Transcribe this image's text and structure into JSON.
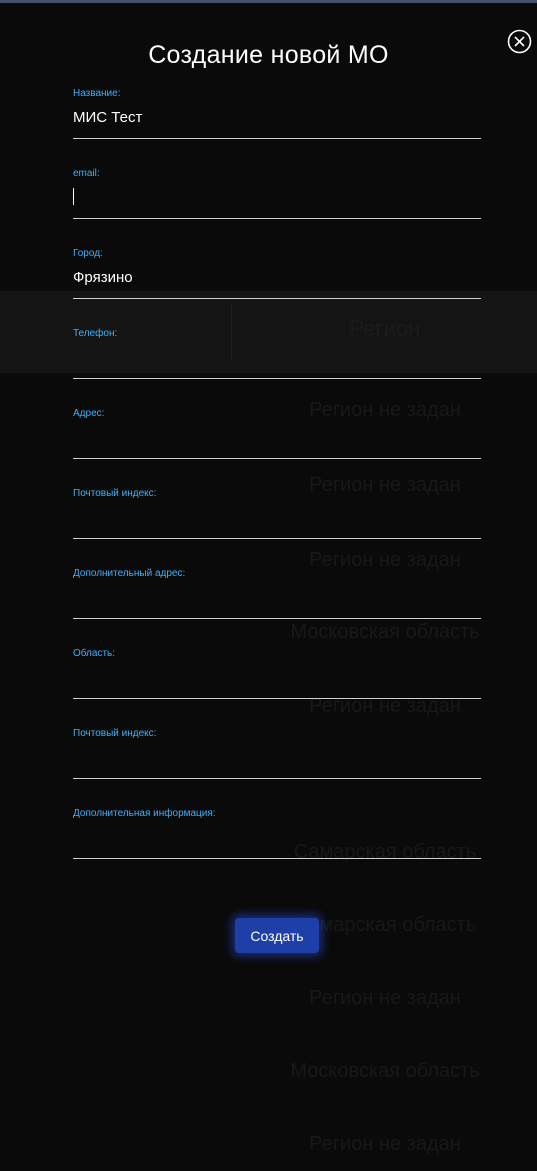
{
  "background": {
    "table_header": "Регион",
    "regions": [
      "Регион не задан",
      "Регион не задан",
      "Регион не задан",
      "Московская область",
      "Регион не задан",
      "Самарская область",
      "Самарская область",
      "Регион не задан",
      "Московская область",
      "Регион не задан"
    ]
  },
  "modal": {
    "title": "Создание новой МО",
    "create_label": "Создать",
    "fields": [
      {
        "label": "Название:",
        "value": "МИС Тест"
      },
      {
        "label": "email:",
        "value": ""
      },
      {
        "label": "Город:",
        "value": "Фрязино"
      },
      {
        "label": "Телефон:",
        "value": ""
      },
      {
        "label": "Адрес:",
        "value": ""
      },
      {
        "label": "Почтовый индекс:",
        "value": ""
      },
      {
        "label": "Дополнительный адрес:",
        "value": ""
      },
      {
        "label": "Область:",
        "value": ""
      },
      {
        "label": "Почтовый индекс:",
        "value": ""
      },
      {
        "label": "Дополнительная информация:",
        "value": ""
      }
    ]
  },
  "colors": {
    "accent_label": "#3fb0ff",
    "button": "#1f3fa8",
    "background": "#0a0a0a"
  },
  "icons": {
    "close": "close-circle-icon"
  }
}
